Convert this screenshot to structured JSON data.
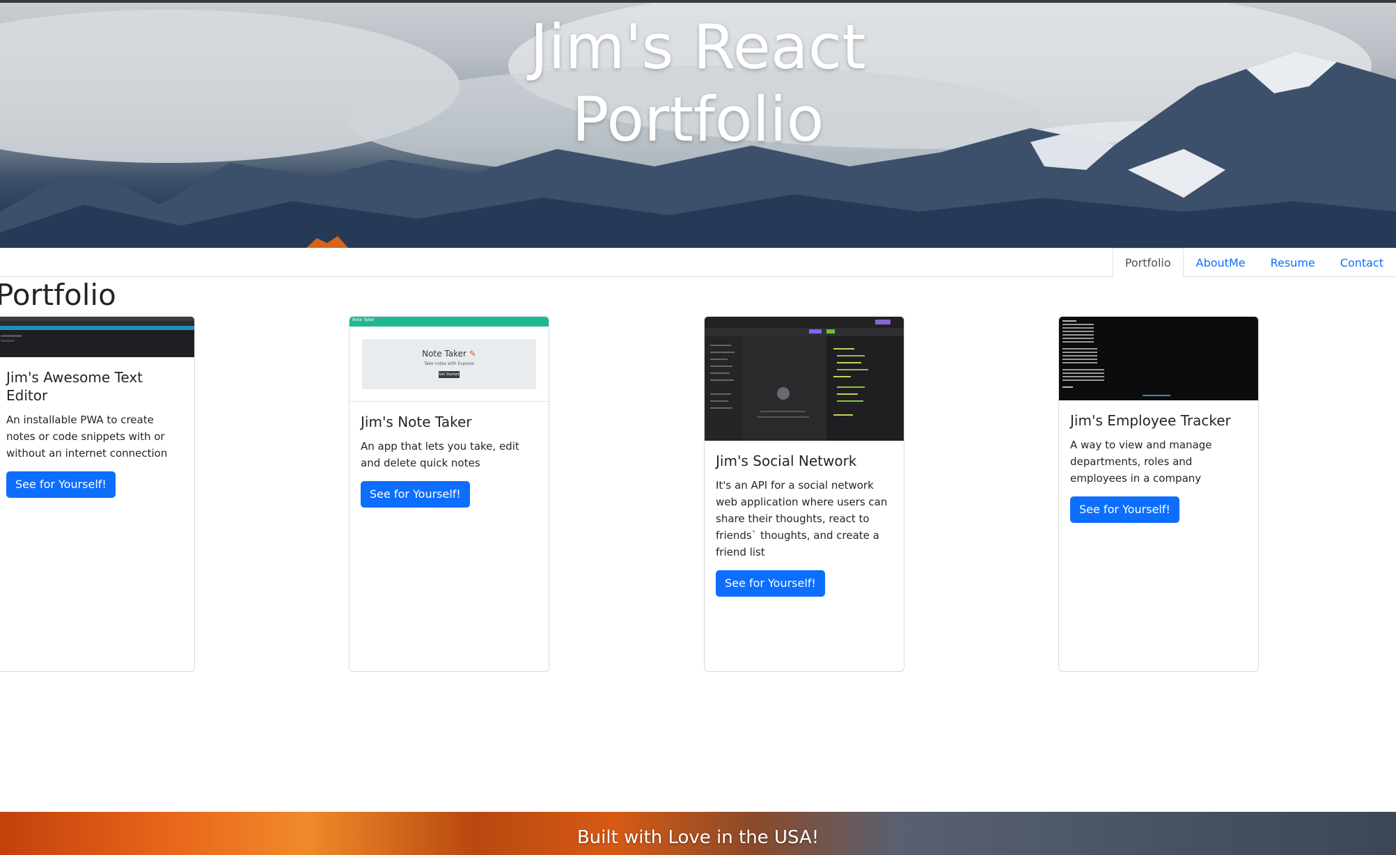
{
  "header": {
    "title_line1": "Jim's React",
    "title_line2": "Portfolio"
  },
  "nav": {
    "tabs": [
      {
        "label": "Portfolio",
        "active": true
      },
      {
        "label": "AboutMe",
        "active": false
      },
      {
        "label": "Resume",
        "active": false
      },
      {
        "label": "Contact",
        "active": false
      }
    ]
  },
  "main": {
    "section_title": "Portfolio",
    "projects": [
      {
        "title": "Jim's Awesome Text Editor",
        "description": "An installable PWA to create notes or code snippets with or without an internet connection",
        "button_label": "See for Yourself!",
        "thumbnail": "text-editor-screenshot"
      },
      {
        "title": "Jim's Note Taker",
        "description": "An app that lets you take, edit and delete quick notes",
        "button_label": "See for Yourself!",
        "thumbnail": "note-taker-screenshot",
        "thumbnail_text": {
          "heading": "Note Taker",
          "subheading": "Take notes with Express",
          "button": "Get Started",
          "nav": "Note Taker"
        }
      },
      {
        "title": "Jim's Social Network",
        "description": "It's an API for a social network web application where users can share their thoughts, react to friends` thoughts, and create a friend list",
        "button_label": "See for Yourself!",
        "thumbnail": "social-network-screenshot"
      },
      {
        "title": "Jim's Employee Tracker",
        "description": "A way to view and manage departments, roles and employees in a company",
        "button_label": "See for Yourself!",
        "thumbnail": "employee-tracker-screenshot"
      }
    ]
  },
  "footer": {
    "text": "Built with Love in the USA!"
  },
  "colors": {
    "primary": "#0d6efd",
    "text": "#212529",
    "border": "#dee2e6",
    "note_taker_bar": "#20b894"
  }
}
